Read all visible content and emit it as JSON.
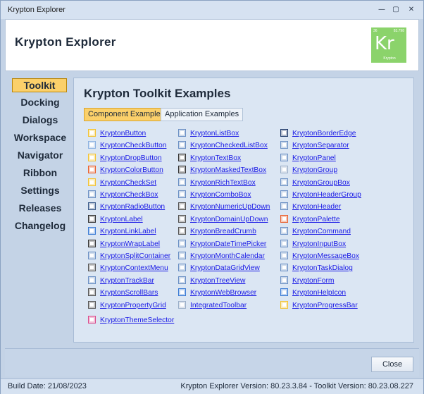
{
  "window": {
    "title": "Krypton Explorer",
    "controls": {
      "minimize": "—",
      "restore": "▢",
      "close": "✕"
    }
  },
  "header": {
    "title": "Krypton Explorer",
    "logo": {
      "symbol": "Kr",
      "number": "36",
      "mass": "83.798",
      "name": "Krypton"
    }
  },
  "sidebar": {
    "items": [
      {
        "label": "Toolkit",
        "active": true
      },
      {
        "label": "Docking"
      },
      {
        "label": "Dialogs"
      },
      {
        "label": "Workspace"
      },
      {
        "label": "Navigator"
      },
      {
        "label": "Ribbon"
      },
      {
        "label": "Settings"
      },
      {
        "label": "Releases"
      },
      {
        "label": "Changelog"
      }
    ]
  },
  "main": {
    "heading": "Krypton Toolkit Examples",
    "tabs": [
      {
        "label": "Component Examples",
        "active": true
      },
      {
        "label": "Application Examples"
      }
    ],
    "columns": [
      [
        {
          "label": "KryptonButton",
          "icon": "button-icon"
        },
        {
          "label": "KryptonCheckButton",
          "icon": "check-button-icon"
        },
        {
          "label": "KryptonDropButton",
          "icon": "drop-button-icon"
        },
        {
          "label": "KryptonColorButton",
          "icon": "color-button-icon"
        },
        {
          "label": "KryptonCheckSet",
          "icon": "check-set-icon"
        },
        {
          "label": "KryptonCheckBox",
          "icon": "checkbox-icon"
        },
        {
          "label": "KryptonRadioButton",
          "icon": "radio-button-icon"
        },
        {
          "label": "KryptonLabel",
          "icon": "label-icon"
        },
        {
          "label": "KryptonLinkLabel",
          "icon": "link-label-icon"
        },
        {
          "label": "KryptonWrapLabel",
          "icon": "wrap-label-icon"
        },
        {
          "label": "KryptonSplitContainer",
          "icon": "split-container-icon"
        },
        {
          "label": "KryptonContextMenu",
          "icon": "context-menu-icon"
        },
        {
          "label": "KryptonTrackBar",
          "icon": "trackbar-icon"
        },
        {
          "label": "KryptonScrollBars",
          "icon": "scrollbars-icon"
        },
        {
          "label": "KryptonPropertyGrid",
          "icon": "property-grid-icon"
        },
        {
          "label": "KryptonThemeSelector",
          "icon": "theme-selector-icon"
        }
      ],
      [
        {
          "label": "KryptonListBox",
          "icon": "listbox-icon"
        },
        {
          "label": "KryptonCheckedListBox",
          "icon": "checked-listbox-icon"
        },
        {
          "label": "KryptonTextBox",
          "icon": "textbox-icon"
        },
        {
          "label": "KryptonMaskedTextBox",
          "icon": "masked-textbox-icon"
        },
        {
          "label": "KryptonRichTextBox",
          "icon": "rich-textbox-icon"
        },
        {
          "label": "KryptonComboBox",
          "icon": "combobox-icon"
        },
        {
          "label": "KryptonNumericUpDown",
          "icon": "numeric-updown-icon"
        },
        {
          "label": "KryptonDomainUpDown",
          "icon": "domain-updown-icon"
        },
        {
          "label": "KryptonBreadCrumb",
          "icon": "breadcrumb-icon"
        },
        {
          "label": "KryptonDateTimePicker",
          "icon": "datetime-picker-icon"
        },
        {
          "label": "KryptonMonthCalendar",
          "icon": "month-calendar-icon"
        },
        {
          "label": "KryptonDataGridView",
          "icon": "datagridview-icon"
        },
        {
          "label": "KryptonTreeView",
          "icon": "treeview-icon"
        },
        {
          "label": "KryptonWebBrowser",
          "icon": "web-browser-icon"
        },
        {
          "label": "IntegratedToolbar",
          "icon": "toolbar-icon"
        }
      ],
      [
        {
          "label": "KryptonBorderEdge",
          "icon": "border-edge-icon"
        },
        {
          "label": "KryptonSeparator",
          "icon": "separator-icon"
        },
        {
          "label": "KryptonPanel",
          "icon": "panel-icon"
        },
        {
          "label": "KryptonGroup",
          "icon": "group-icon"
        },
        {
          "label": "KryptonGroupBox",
          "icon": "groupbox-icon"
        },
        {
          "label": "KryptonHeaderGroup",
          "icon": "header-group-icon"
        },
        {
          "label": "KryptonHeader",
          "icon": "header-icon"
        },
        {
          "label": "KryptonPalette",
          "icon": "palette-icon"
        },
        {
          "label": "KryptonCommand",
          "icon": "command-icon"
        },
        {
          "label": "KryptonInputBox",
          "icon": "input-box-icon"
        },
        {
          "label": "KryptonMessageBox",
          "icon": "message-box-icon"
        },
        {
          "label": "KryptonTaskDialog",
          "icon": "task-dialog-icon"
        },
        {
          "label": "KryptonForm",
          "icon": "form-icon"
        },
        {
          "label": "KryptonHelpIcon",
          "icon": "help-icon"
        },
        {
          "label": "KryptonProgressBar",
          "icon": "progressbar-icon"
        }
      ]
    ]
  },
  "footer": {
    "close_label": "Close"
  },
  "status": {
    "build_date": "Build Date: 21/08/2023",
    "version": "Krypton Explorer Version: 80.23.3.84 - Toolkit Version: 80.23.08.227"
  }
}
